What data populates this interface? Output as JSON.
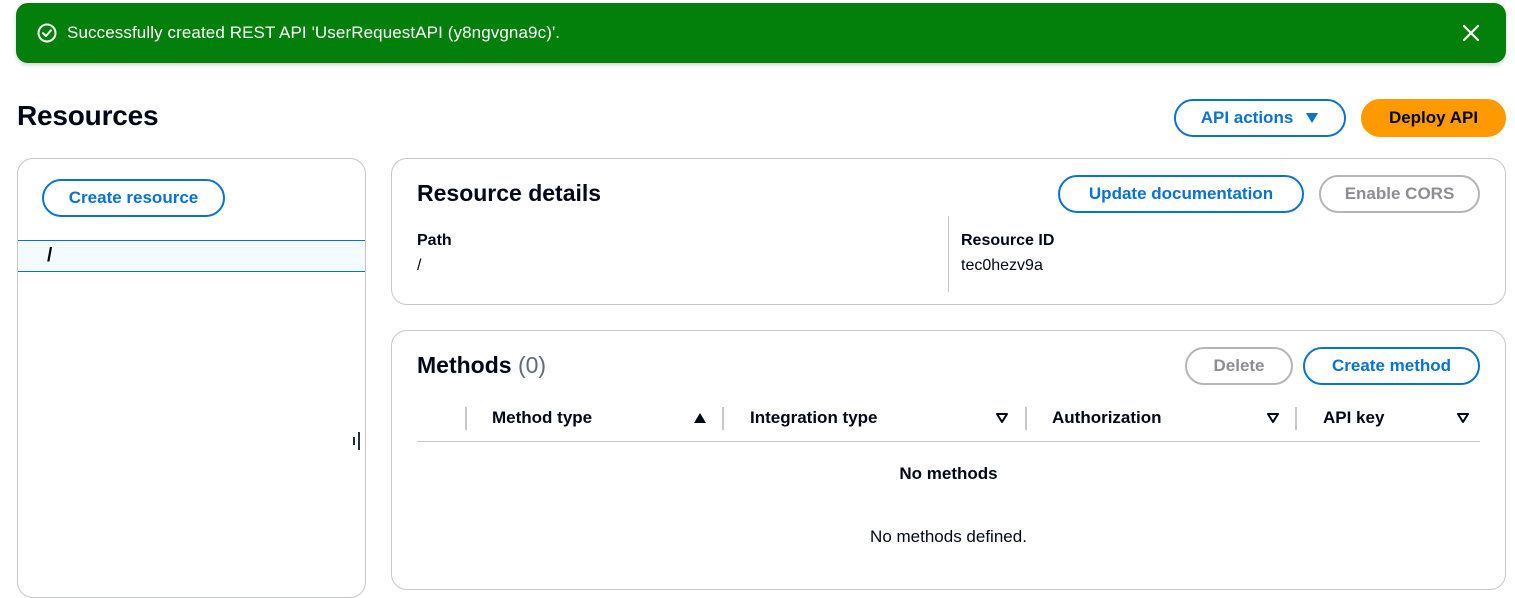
{
  "flash": {
    "message": "Successfully created REST API 'UserRequestAPI (y8ngvgna9c)'.",
    "status": "success",
    "color": "#037f0c",
    "icon": "check-circle-icon",
    "dismiss_icon": "close-icon"
  },
  "header": {
    "title": "Resources",
    "api_actions_label": "API actions",
    "deploy_label": "Deploy API"
  },
  "resource_tree": {
    "create_label": "Create resource",
    "items": [
      {
        "path": "/",
        "selected": true
      }
    ]
  },
  "resource_details": {
    "title": "Resource details",
    "update_doc_label": "Update documentation",
    "enable_cors_label": "Enable CORS",
    "path_label": "Path",
    "path_value": "/",
    "resource_id_label": "Resource ID",
    "resource_id_value": "tec0hezv9a"
  },
  "methods": {
    "title": "Methods",
    "count": "(0)",
    "delete_label": "Delete",
    "create_label": "Create method",
    "columns": [
      {
        "label": "Method type",
        "sort": "ascending"
      },
      {
        "label": "Integration type",
        "sort": "none"
      },
      {
        "label": "Authorization",
        "sort": "none"
      },
      {
        "label": "API key",
        "sort": "none"
      }
    ],
    "empty_title": "No methods",
    "empty_description": "No methods defined."
  },
  "colors": {
    "accent": "#0972d3",
    "primary_button": "#ff9900",
    "success": "#037f0c",
    "border": "#c6c6cd"
  }
}
